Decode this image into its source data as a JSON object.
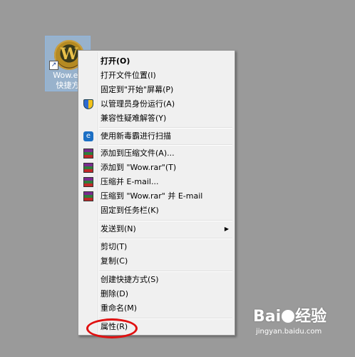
{
  "desktop_icon": {
    "label_line1": "Wow.ex",
    "label_line2": "快捷方",
    "icon": "wow-game-icon",
    "glyph": "W",
    "shortcut_glyph": "↗"
  },
  "context_menu": {
    "items": [
      {
        "label": "打开(O)",
        "icon": null
      },
      {
        "label": "打开文件位置(I)",
        "icon": null
      },
      {
        "label": "固定到\"开始\"屏幕(P)",
        "icon": null
      },
      {
        "label": "以管理员身份运行(A)",
        "icon": "uac-shield-icon"
      },
      {
        "label": "兼容性疑难解答(Y)",
        "icon": null
      },
      {
        "label": "使用新毒霸进行扫描",
        "icon": "antivirus-icon"
      },
      {
        "label": "添加到压缩文件(A)...",
        "icon": "winrar-icon"
      },
      {
        "label": "添加到 \"Wow.rar\"(T)",
        "icon": "winrar-icon"
      },
      {
        "label": "压缩并 E-mail...",
        "icon": "winrar-icon"
      },
      {
        "label": "压缩到 \"Wow.rar\" 并 E-mail",
        "icon": "winrar-icon"
      },
      {
        "label": "固定到任务栏(K)",
        "icon": null
      },
      {
        "label": "发送到(N)",
        "icon": null,
        "submenu_arrow": "▶"
      },
      {
        "label": "剪切(T)",
        "icon": null
      },
      {
        "label": "复制(C)",
        "icon": null
      },
      {
        "label": "创建快捷方式(S)",
        "icon": null
      },
      {
        "label": "删除(D)",
        "icon": null
      },
      {
        "label": "重命名(M)",
        "icon": null
      },
      {
        "label": "属性(R)",
        "icon": null
      }
    ],
    "av_glyph": "e"
  },
  "annotation": {
    "highlight_color": "#e01010",
    "highlighted_item": "属性(R)"
  },
  "watermark": {
    "logo": "Bai",
    "logo_suffix": "经验",
    "url": "jingyan.baidu.com"
  }
}
